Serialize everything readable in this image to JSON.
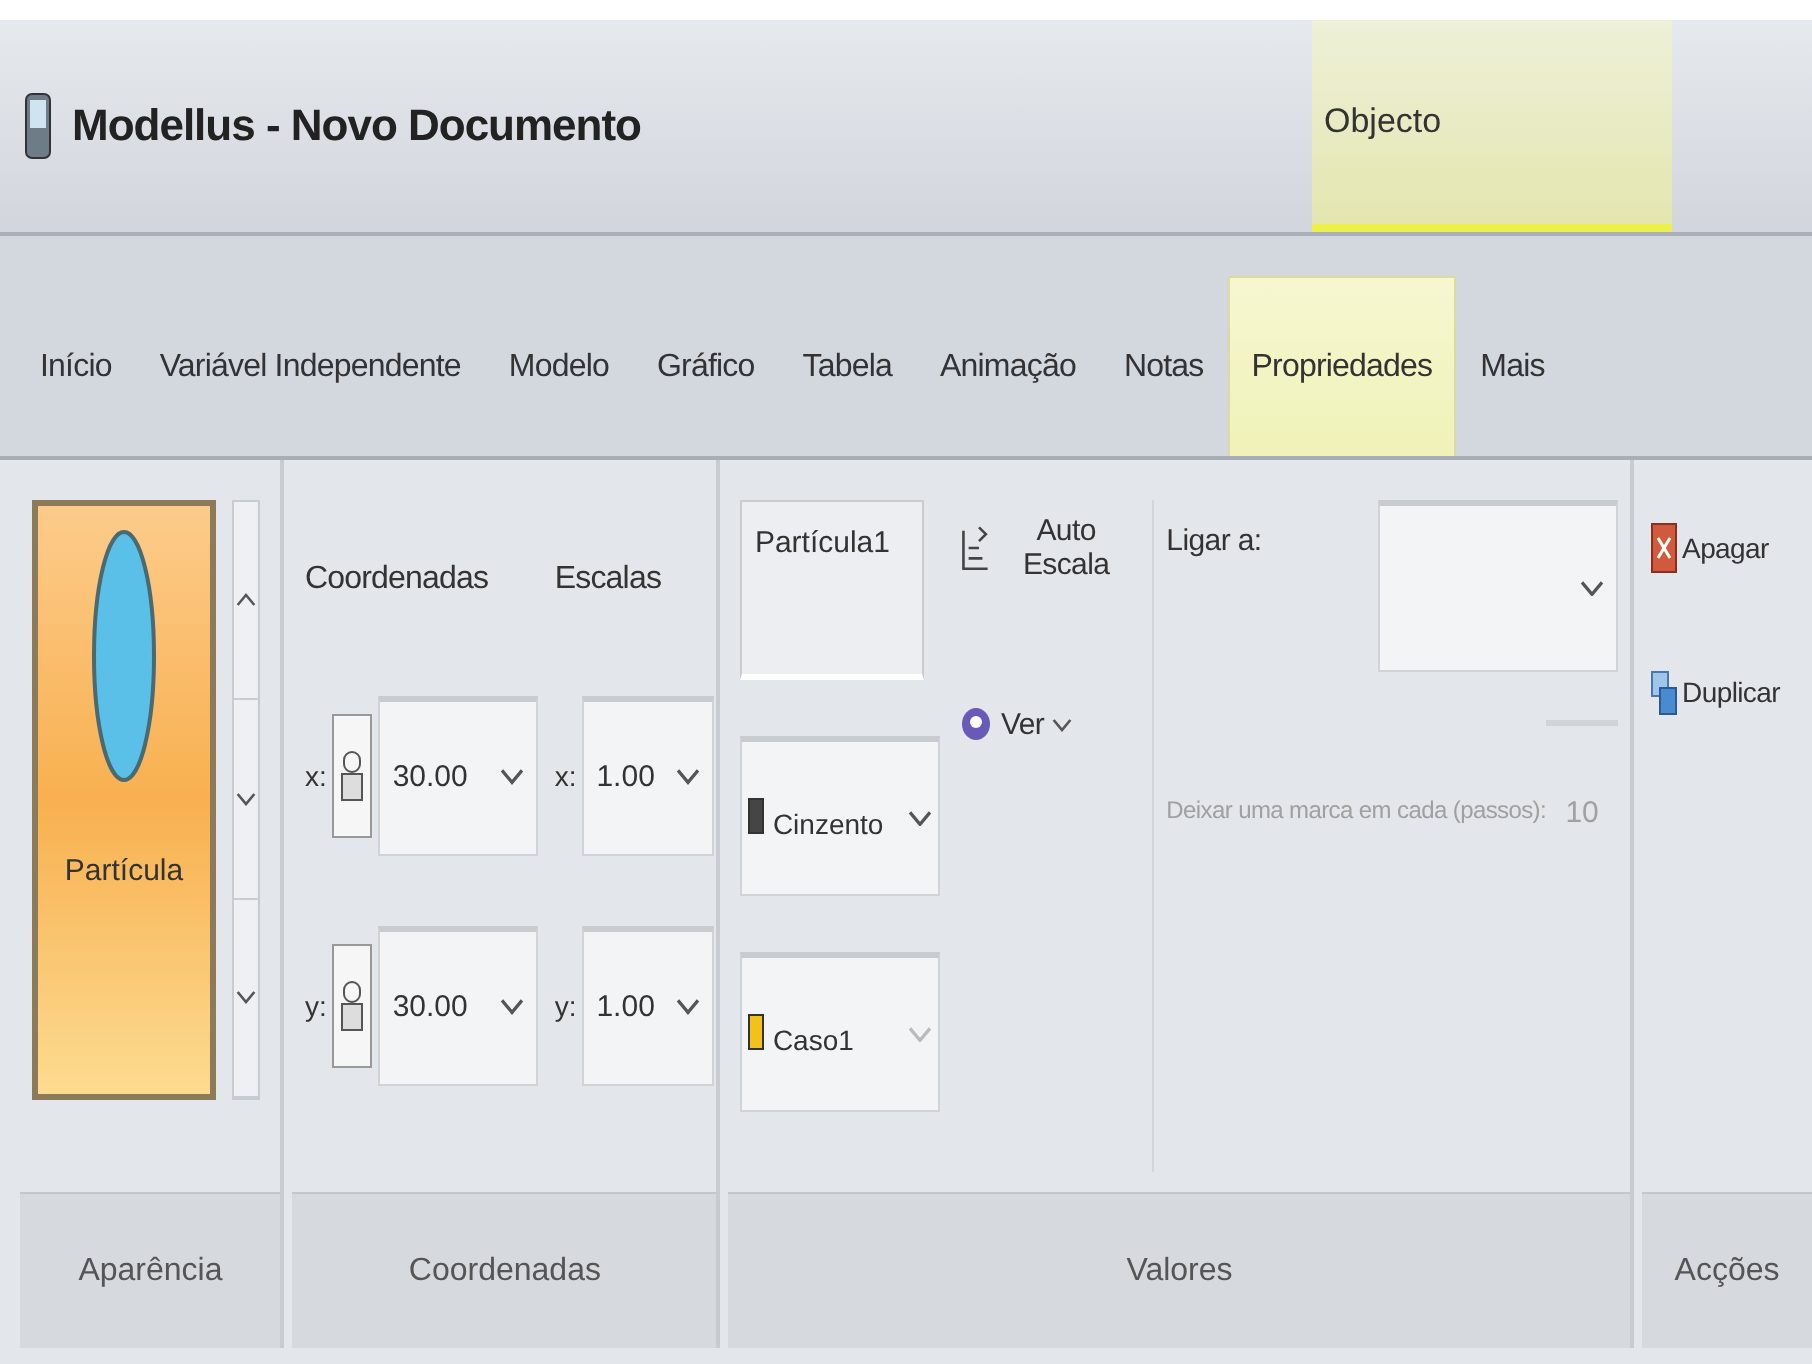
{
  "window": {
    "title": "Modellus - Novo Documento"
  },
  "context_tab": {
    "label": "Objecto"
  },
  "tabs": [
    {
      "label": "Início",
      "selected": false
    },
    {
      "label": "Variável Independente",
      "selected": false
    },
    {
      "label": "Modelo",
      "selected": false
    },
    {
      "label": "Gráfico",
      "selected": false
    },
    {
      "label": "Tabela",
      "selected": false
    },
    {
      "label": "Animação",
      "selected": false
    },
    {
      "label": "Notas",
      "selected": false
    },
    {
      "label": "Propriedades",
      "selected": true
    },
    {
      "label": "Mais",
      "selected": false
    }
  ],
  "appearance": {
    "label": "Aparência",
    "gallery": [
      {
        "label": "Partícula",
        "selected": true
      }
    ]
  },
  "coordinates": {
    "label": "Coordenadas",
    "coordinates_header": "Coordenadas",
    "scales_header": "Escalas",
    "rows": [
      {
        "axis": "x:",
        "value": "30.00",
        "scale_axis": "x:",
        "scale": "1.00"
      },
      {
        "axis": "y:",
        "value": "30.00",
        "scale_axis": "y:",
        "scale": "1.00"
      }
    ]
  },
  "values": {
    "label": "Valores",
    "name": "Partícula1",
    "color_dropdown": {
      "value": "Cinzento",
      "color": "#454545",
      "disabled": false
    },
    "case_dropdown": {
      "value": "Caso1",
      "color": "#f2c21c",
      "disabled": true
    },
    "auto_scale": "Auto Escala",
    "view": "Ver",
    "link_label": "Ligar a:",
    "mark": {
      "label": "Deixar uma marca em cada (passos):",
      "value": "10",
      "disabled": true
    }
  },
  "actions": {
    "label": "Acções",
    "buttons": [
      {
        "kind": "delete",
        "label": "Apagar"
      },
      {
        "kind": "duplicate",
        "label": "Duplicar"
      }
    ]
  }
}
